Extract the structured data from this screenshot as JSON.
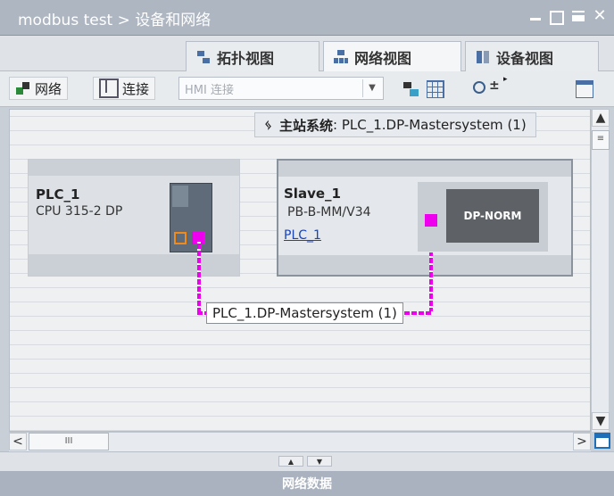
{
  "window": {
    "title": "modbus test > 设备和网络",
    "controls": [
      "minimize-icon",
      "restore-icon",
      "maximize-icon",
      "close-icon"
    ]
  },
  "view_tabs": [
    {
      "label": "拓扑视图",
      "icon": "topology-view-icon",
      "active": false
    },
    {
      "label": "网络视图",
      "icon": "network-view-icon",
      "active": true
    },
    {
      "label": "设备视图",
      "icon": "device-view-icon",
      "active": false
    }
  ],
  "toolbar": {
    "network_label": "网络",
    "connect_label": "连接",
    "connection_type": "HMI 连接",
    "zoom_icon": "zoom-icon"
  },
  "canvas": {
    "master_system_prefix": "主站系统",
    "master_system_value": ": PLC_1.DP-Mastersystem (1)",
    "devices": [
      {
        "name": "PLC_1",
        "type": "CPU 315-2 DP",
        "link": ""
      },
      {
        "name": "Slave_1",
        "type": "PB-B-MM/V34",
        "link": "PLC_1",
        "module_label": "DP-NORM"
      }
    ],
    "bus_label": "PLC_1.DP-Mastersystem (1)"
  },
  "scroll": {
    "left": "<",
    "right": ">",
    "up": "^",
    "down": "v",
    "thumb": "III"
  },
  "bottom": {
    "label": "网络数据"
  },
  "colors": {
    "profibus": "#ee00ee",
    "title_bar": "#aeb6c1",
    "link": "#1a44b8"
  }
}
